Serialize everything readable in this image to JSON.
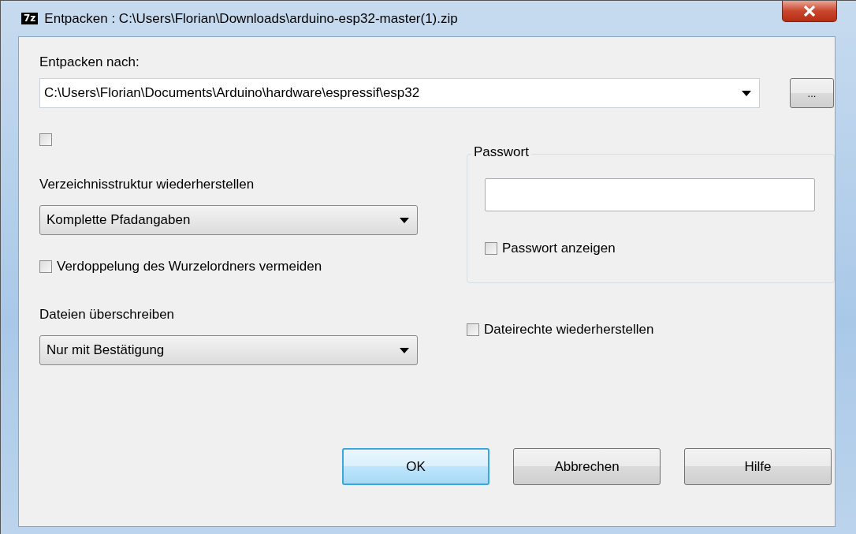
{
  "window": {
    "icon_text": "7z",
    "title": "Entpacken : C:\\Users\\Florian\\Downloads\\arduino-esp32-master(1).zip"
  },
  "extract_to": {
    "label": "Entpacken nach:",
    "value": "C:\\Users\\Florian\\Documents\\Arduino\\hardware\\espressif\\esp32",
    "browse": "..."
  },
  "unnamed_checkbox": {
    "checked": false
  },
  "path_mode": {
    "label": "Verzeichnisstruktur wiederherstellen",
    "value": "Komplette Pfadangaben"
  },
  "avoid_duplicate_root": {
    "label": "Verdoppelung des Wurzelordners vermeiden",
    "checked": false
  },
  "overwrite": {
    "label": "Dateien überschreiben",
    "value": "Nur mit Bestätigung"
  },
  "password": {
    "title": "Passwort",
    "show": {
      "label": "Passwort anzeigen",
      "checked": false
    }
  },
  "restore_permissions": {
    "label": "Dateirechte wiederherstellen",
    "checked": false
  },
  "buttons": [
    {
      "label": "OK",
      "default": true
    },
    {
      "label": "Abbrechen",
      "default": false
    },
    {
      "label": "Hilfe",
      "default": false
    }
  ]
}
